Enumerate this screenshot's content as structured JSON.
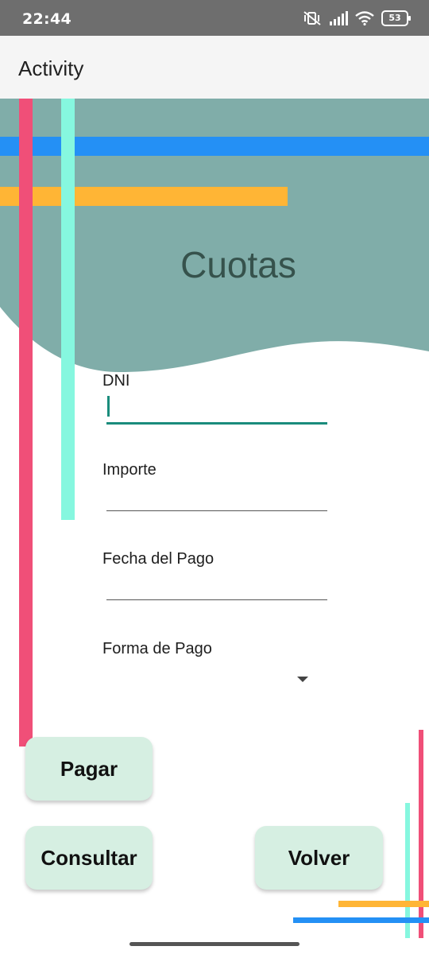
{
  "status_bar": {
    "time": "22:44",
    "battery": "53",
    "icons": [
      "vibrate-off-icon",
      "signal-icon",
      "wifi-icon",
      "battery-icon"
    ]
  },
  "app_bar": {
    "title": "Activity"
  },
  "header": {
    "title": "Cuotas"
  },
  "form": {
    "dni": {
      "label": "DNI",
      "value": ""
    },
    "importe": {
      "label": "Importe",
      "value": ""
    },
    "fecha": {
      "label": "Fecha del Pago",
      "value": ""
    },
    "forma": {
      "label": "Forma de Pago",
      "selected": ""
    }
  },
  "buttons": {
    "pagar": "Pagar",
    "consultar": "Consultar",
    "volver": "Volver"
  },
  "colors": {
    "hero_bg": "#80ada9",
    "stripe_red": "#f04f78",
    "stripe_mint": "#86f7df",
    "stripe_blue": "#2490f5",
    "stripe_yellow": "#ffb535",
    "button_bg": "#d6efe2",
    "accent": "#1a8c7c"
  }
}
